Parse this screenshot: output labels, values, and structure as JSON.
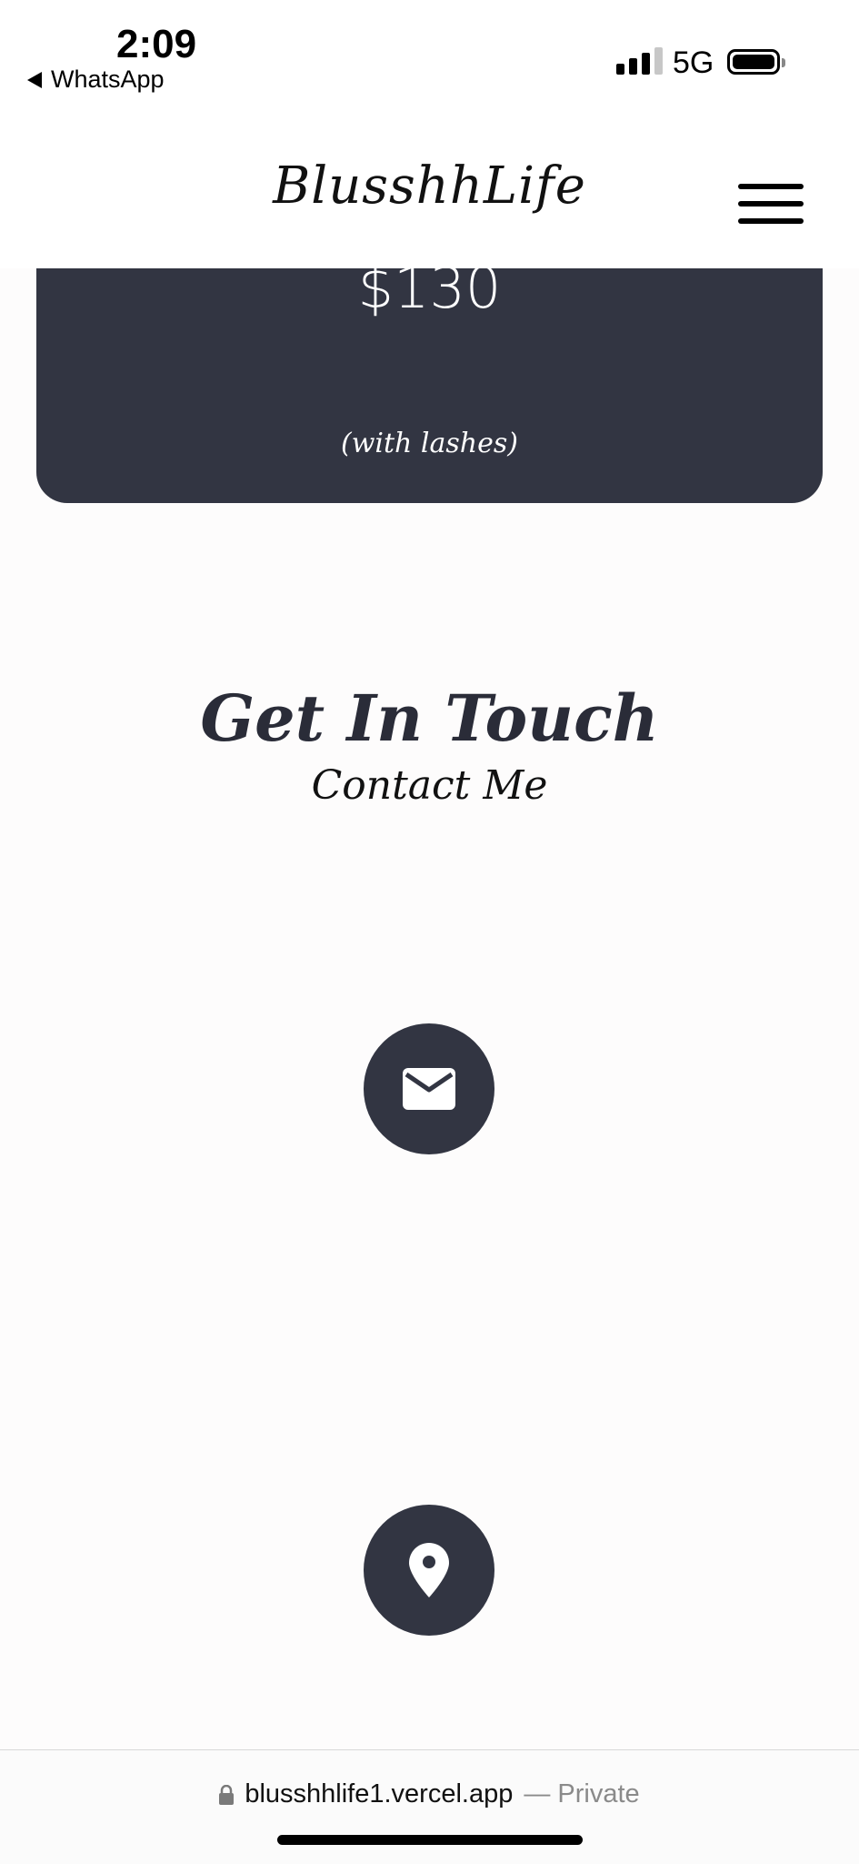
{
  "status_bar": {
    "time": "2:09",
    "back_app": "WhatsApp",
    "network": "5G",
    "signal_bars_active": 3,
    "signal_bars_total": 4
  },
  "header": {
    "brand": "BlusshhLife",
    "menu_icon": "hamburger-menu-icon"
  },
  "pricing": {
    "price": "$130",
    "note": "(with lashes)"
  },
  "contact": {
    "title": "Get In Touch",
    "subtitle": "Contact Me",
    "email_icon": "envelope-icon",
    "location_icon": "map-pin-icon"
  },
  "browser": {
    "lock_icon": "lock-icon",
    "url": "blusshhlife1.vercel.app",
    "privacy": "— Private"
  },
  "colors": {
    "accent_dark": "#323542",
    "page_background": "#fdfcfc"
  }
}
